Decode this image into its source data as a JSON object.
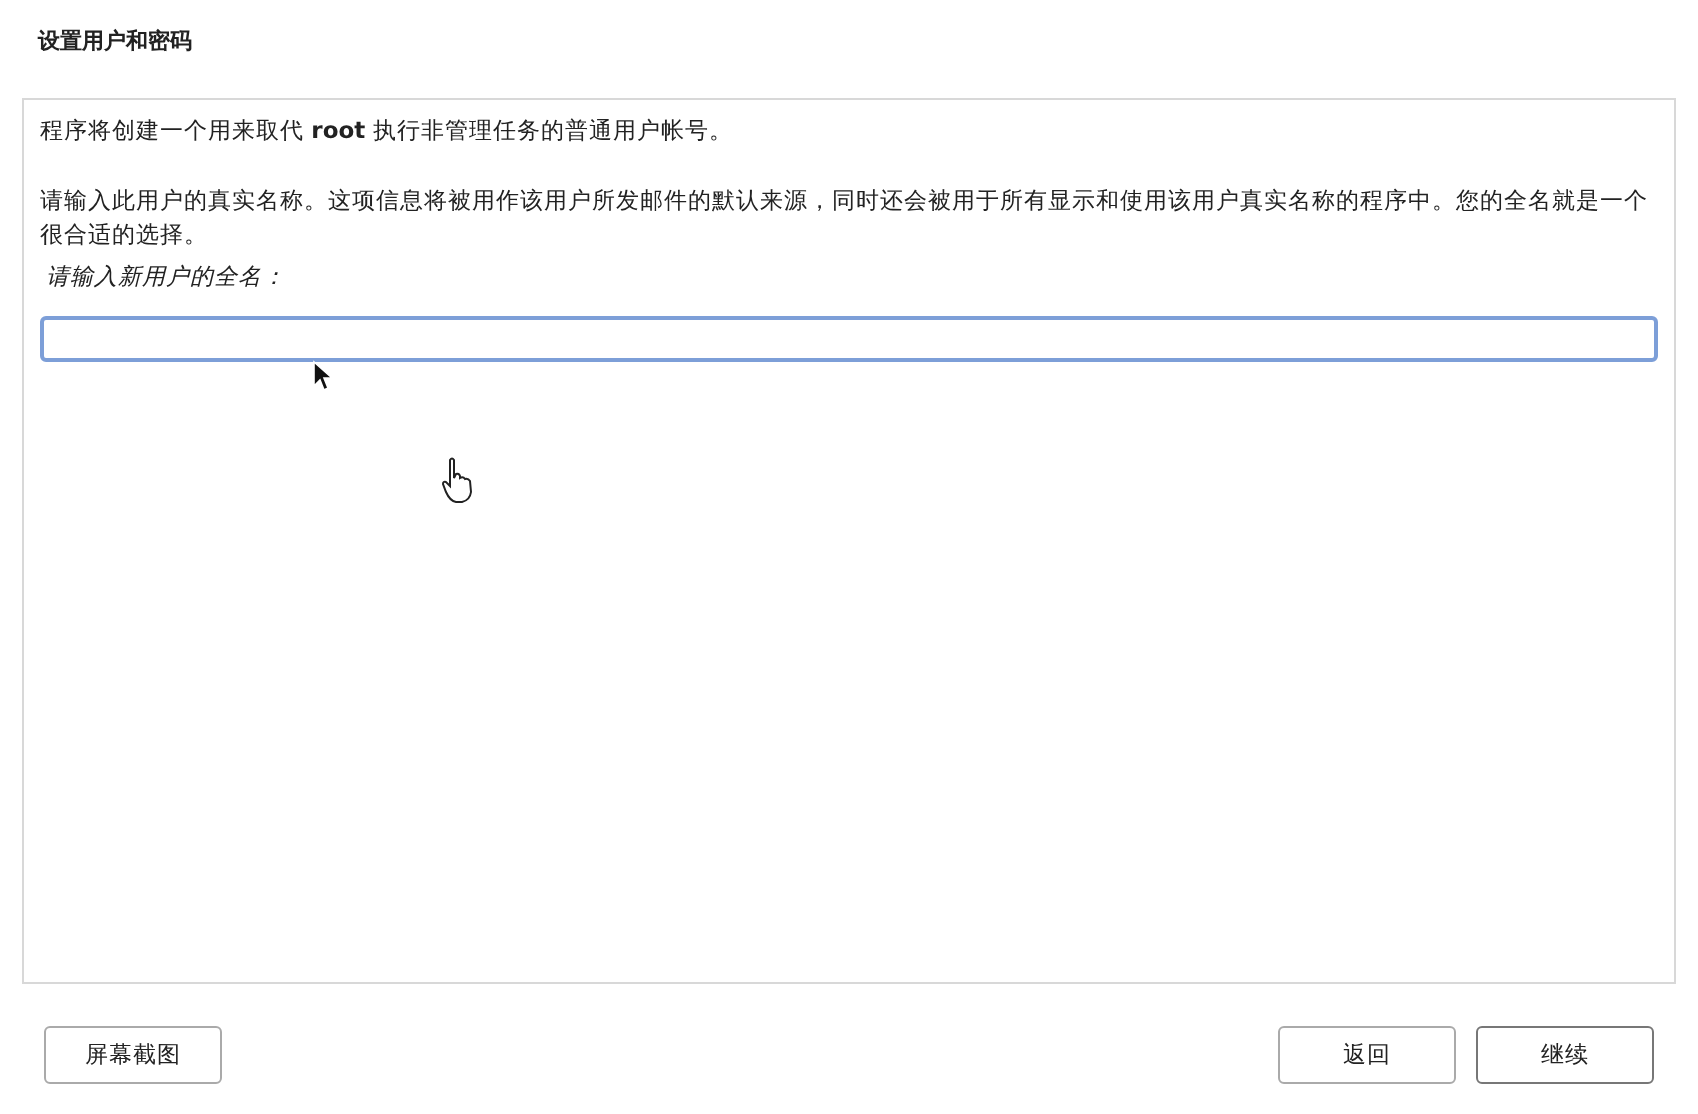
{
  "window": {
    "title": "设置用户和密码"
  },
  "intro": "程序将创建一个用来取代 **root** 执行非管理任务的普通用户帐号。",
  "description": "请输入此用户的真实名称。这项信息将被用作该用户所发邮件的默认来源，同时还会被用于所有显示和使用该用户真实名称的程序中。您的全名就是一个很合适的选择。",
  "field": {
    "label": "请输入新用户的全名：",
    "focused": true
  },
  "buttons": [
    {
      "kind": "screenshot",
      "label": "屏幕截图"
    },
    {
      "kind": "back",
      "label": "返回"
    },
    {
      "kind": "continue",
      "label": "继续"
    }
  ]
}
